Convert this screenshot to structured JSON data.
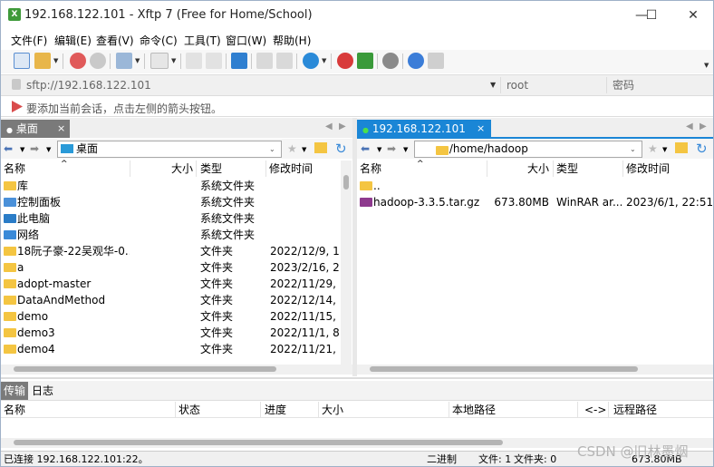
{
  "window": {
    "title": "192.168.122.101 - Xftp 7 (Free for Home/School)",
    "app_icon": "xftp-icon",
    "minimize": "—",
    "maximize": "☐",
    "close": "✕"
  },
  "menu": [
    "文件(F)",
    "编辑(E)",
    "查看(V)",
    "命令(C)",
    "工具(T)",
    "窗口(W)",
    "帮助(H)"
  ],
  "address": {
    "url": "sftp://192.168.122.101",
    "user_placeholder": "root",
    "password_placeholder": "密码"
  },
  "info_text": "要添加当前会话，点击左侧的箭头按钮。",
  "left_pane": {
    "tab_label": "桌面",
    "tab_close": "×",
    "path": "桌面",
    "columns": [
      "名称",
      "大小",
      "类型",
      "修改时间"
    ],
    "rows": [
      {
        "name": "库",
        "size": "",
        "type": "系统文件夹",
        "modified": "",
        "icon": "library"
      },
      {
        "name": "控制面板",
        "size": "",
        "type": "系统文件夹",
        "modified": "",
        "icon": "control-panel"
      },
      {
        "name": "此电脑",
        "size": "",
        "type": "系统文件夹",
        "modified": "",
        "icon": "computer"
      },
      {
        "name": "网络",
        "size": "",
        "type": "系统文件夹",
        "modified": "",
        "icon": "network"
      },
      {
        "name": "18阮子豪-22吴观华-0...",
        "size": "",
        "type": "文件夹",
        "modified": "2022/12/9, 19",
        "icon": "folder"
      },
      {
        "name": "a",
        "size": "",
        "type": "文件夹",
        "modified": "2023/2/16, 2:",
        "icon": "folder"
      },
      {
        "name": "adopt-master",
        "size": "",
        "type": "文件夹",
        "modified": "2022/11/29, 1",
        "icon": "folder"
      },
      {
        "name": "DataAndMethod",
        "size": "",
        "type": "文件夹",
        "modified": "2022/12/14, 1",
        "icon": "folder"
      },
      {
        "name": "demo",
        "size": "",
        "type": "文件夹",
        "modified": "2022/11/15, 1",
        "icon": "folder"
      },
      {
        "name": "demo3",
        "size": "",
        "type": "文件夹",
        "modified": "2022/11/1, 8:",
        "icon": "folder"
      },
      {
        "name": "demo4",
        "size": "",
        "type": "文件夹",
        "modified": "2022/11/21, 9",
        "icon": "folder"
      }
    ]
  },
  "right_pane": {
    "tab_label": "192.168.122.101",
    "tab_close": "×",
    "path": "/home/hadoop",
    "columns": [
      "名称",
      "大小",
      "类型",
      "修改时间"
    ],
    "rows": [
      {
        "name": "..",
        "size": "",
        "type": "",
        "modified": "",
        "icon": "folder"
      },
      {
        "name": "hadoop-3.3.5.tar.gz",
        "size": "673.80MB",
        "type": "WinRAR ar...",
        "modified": "2023/6/1, 22:51",
        "icon": "archive"
      }
    ]
  },
  "transfer": {
    "tabs": [
      "传输",
      "日志"
    ],
    "columns": [
      "名称",
      "状态",
      "进度",
      "大小",
      "本地路径",
      "<->",
      "远程路径"
    ]
  },
  "status": {
    "connection": "已连接 192.168.122.101:22。",
    "mode": "二进制",
    "files": "文件: 1",
    "folders": "文件夹: 0",
    "size": "673.80MB"
  },
  "watermark": "CSDN @旧林墨烟",
  "colors": {
    "accent": "#1a86d6",
    "folder": "#f4c542"
  }
}
